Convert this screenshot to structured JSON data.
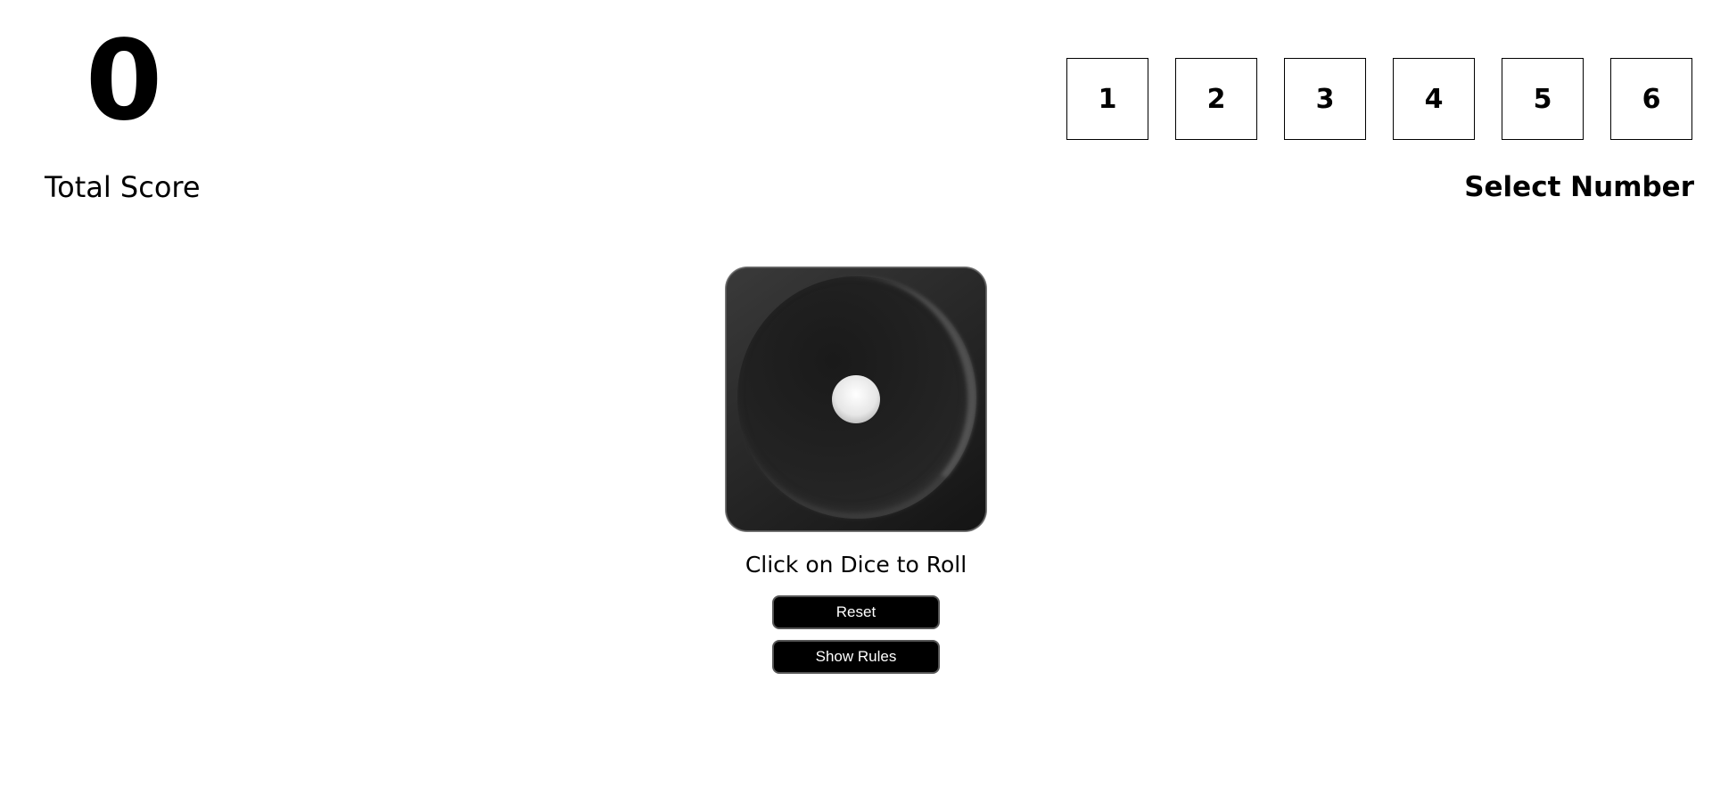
{
  "score": {
    "value": "0",
    "label": "Total Score"
  },
  "number_selector": {
    "label": "Select Number",
    "options": [
      "1",
      "2",
      "3",
      "4",
      "5",
      "6"
    ]
  },
  "dice": {
    "current_face": 1,
    "hint": "Click on Dice to Roll"
  },
  "buttons": {
    "reset": "Reset",
    "show_rules": "Show Rules"
  }
}
